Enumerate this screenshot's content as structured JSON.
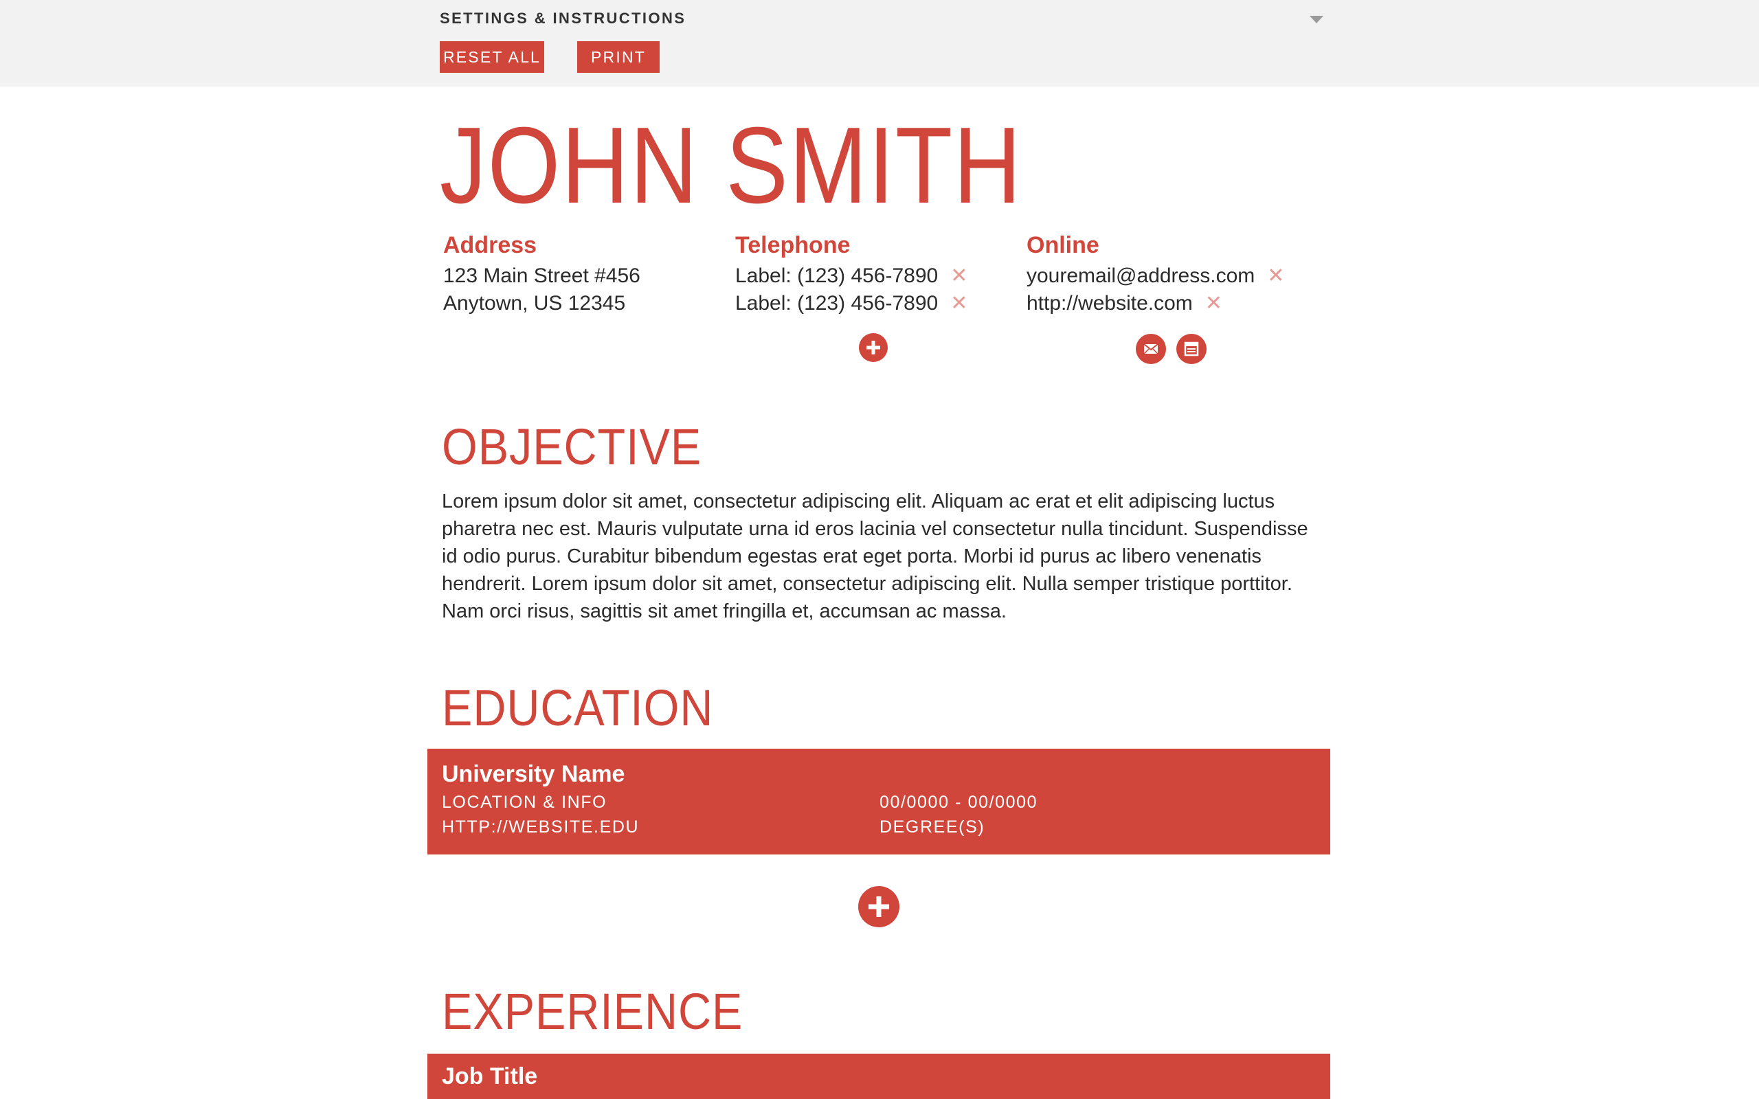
{
  "settings": {
    "title": "SETTINGS & INSTRUCTIONS",
    "reset_label": "RESET ALL",
    "print_label": "PRINT"
  },
  "name": "JOHN SMITH",
  "contact": {
    "address": {
      "label": "Address",
      "lines": [
        "123 Main Street #456",
        "Anytown, US 12345"
      ]
    },
    "telephone": {
      "label": "Telephone",
      "lines": [
        "Label: (123) 456-7890",
        "Label: (123) 456-7890"
      ]
    },
    "online": {
      "label": "Online",
      "lines": [
        "youremail@address.com",
        "http://website.com"
      ]
    }
  },
  "objective": {
    "title": "OBJECTIVE",
    "text": "Lorem ipsum dolor sit amet, consectetur adipiscing elit. Aliquam ac erat et elit adipiscing luctus pharetra nec est. Mauris vulputate urna id eros lacinia vel consectetur nulla tincidunt. Suspendisse id odio purus. Curabitur bibendum egestas erat eget porta. Morbi id purus ac libero venenatis hendrerit. Lorem ipsum dolor sit amet, consectetur adipiscing elit. Nulla semper tristique porttitor. Nam orci risus, sagittis sit amet fringilla et, accumsan ac massa."
  },
  "education": {
    "title": "EDUCATION",
    "entry": {
      "name": "University Name",
      "location": "LOCATION & INFO",
      "website": "HTTP://WEBSITE.EDU",
      "dates": "00/0000 - 00/0000",
      "degree": "DEGREE(S)"
    }
  },
  "experience": {
    "title": "EXPERIENCE",
    "entry": {
      "job_title": "Job Title"
    }
  },
  "icons": {
    "remove": "close-icon",
    "add": "plus-icon",
    "email": "envelope-icon",
    "website": "browser-icon",
    "settings_toggle": "caret-down-icon"
  },
  "colors": {
    "accent": "#d0463b",
    "remove_icon": "#e79a93",
    "topbar_bg": "#f2f2f2"
  }
}
